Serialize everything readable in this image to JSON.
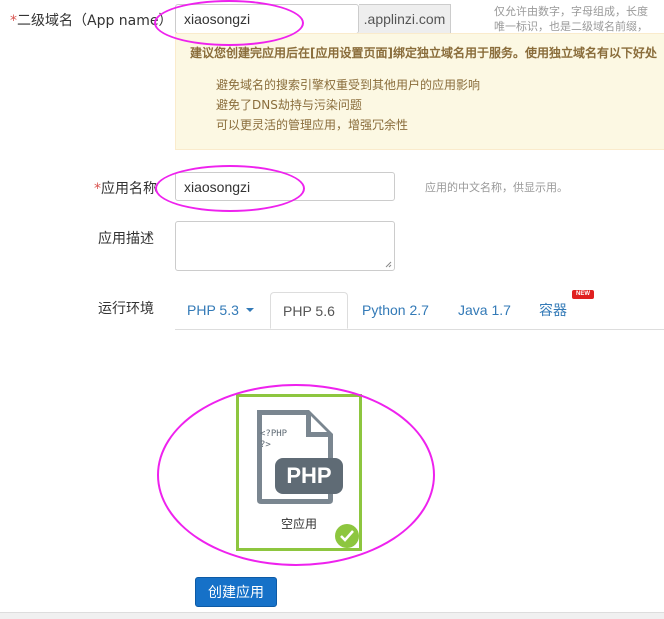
{
  "form": {
    "subdomain": {
      "required_mark": "*",
      "label": "二级域名（App name）",
      "value": "xiaosongzi",
      "suffix": ".applinzi.com",
      "hint_line1": "仅允许由数字，字母组成，长度",
      "hint_line2": "唯一标识，也是二级域名前缀，"
    },
    "tip": {
      "heading": "建议您创建完应用后在[应用设置页面]绑定独立域名用于服务。使用独立域名有以下好处",
      "items": [
        "避免域名的搜索引擎权重受到其他用户的应用影响",
        "避免了DNS劫持与污染问题",
        "可以更灵活的管理应用，增强冗余性"
      ]
    },
    "app_name": {
      "required_mark": "*",
      "label": "应用名称",
      "value": "xiaosongzi",
      "hint": "应用的中文名称，供显示用。"
    },
    "description": {
      "label": "应用描述",
      "value": ""
    },
    "runtime": {
      "label": "运行环境",
      "tabs": [
        {
          "label": "PHP 5.3",
          "dropdown": true
        },
        {
          "label": "PHP 5.6",
          "active": true
        },
        {
          "label": "Python 2.7"
        },
        {
          "label": "Java 1.7"
        },
        {
          "label": "容器",
          "badge": "NEW"
        }
      ]
    },
    "template": {
      "icon_code": "<?PHP\n?>",
      "icon_badge": "PHP",
      "label": "空应用",
      "selected": true
    },
    "submit_label": "创建应用"
  },
  "colors": {
    "annotation": "#ee22ee",
    "selected_border": "#8dc63f",
    "primary_button": "#1671c8",
    "link": "#337ab7",
    "tip_background": "#fcf8e3",
    "tip_text": "#8a6d3b"
  }
}
